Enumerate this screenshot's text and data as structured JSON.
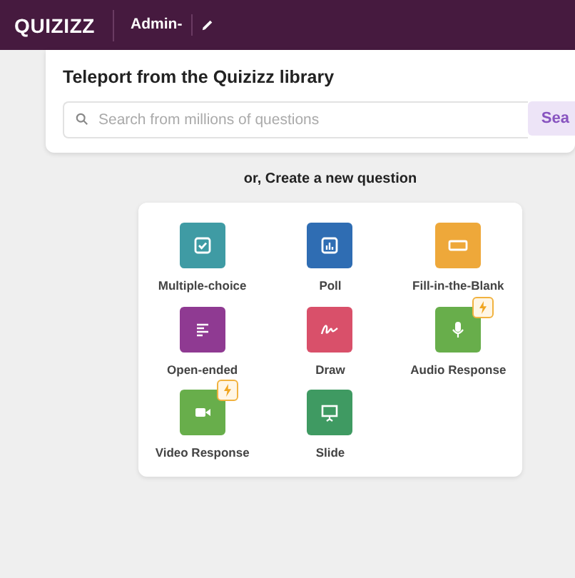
{
  "header": {
    "logo": "QUIZIZZ",
    "title": "Admin-"
  },
  "library": {
    "heading": "Teleport from the Quizizz library",
    "search": {
      "placeholder": "Search from millions of questions"
    },
    "button": "Sea"
  },
  "create_label": "or, Create a new question",
  "question_types": [
    {
      "kind": "checkbox",
      "label": "Multiple-choice",
      "color": "#3f9ba4",
      "badge": false
    },
    {
      "kind": "poll",
      "label": "Poll",
      "color": "#2f6db3",
      "badge": false
    },
    {
      "kind": "blank",
      "label": "Fill-in-the-Blank",
      "color": "#eea83a",
      "badge": false
    },
    {
      "kind": "lines",
      "label": "Open-ended",
      "color": "#8f3a92",
      "badge": false
    },
    {
      "kind": "scribble",
      "label": "Draw",
      "color": "#d9506a",
      "badge": false
    },
    {
      "kind": "mic",
      "label": "Audio Response",
      "color": "#68ae4b",
      "badge": true
    },
    {
      "kind": "camera",
      "label": "Video Response",
      "color": "#68ae4b",
      "badge": true
    },
    {
      "kind": "easel",
      "label": "Slide",
      "color": "#3f9a62",
      "badge": false
    }
  ]
}
